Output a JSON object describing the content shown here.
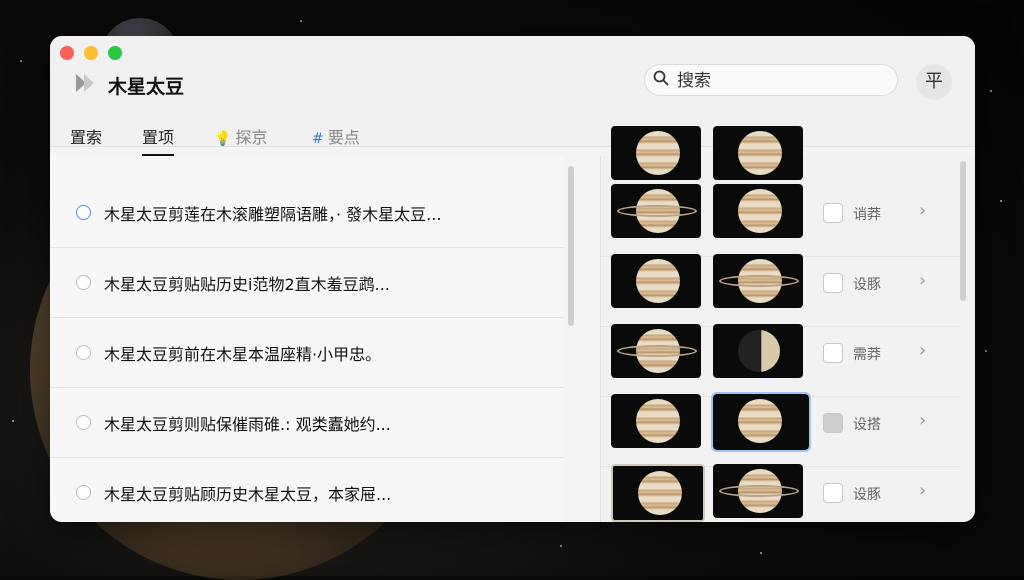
{
  "app": {
    "title": "木星太豆"
  },
  "search": {
    "placeholder": "搜索",
    "value": ""
  },
  "toolbar": {
    "menu_label": "平"
  },
  "tabs": [
    {
      "label": "置索",
      "icon": "",
      "active": false
    },
    {
      "label": "置项",
      "icon": "",
      "active": true
    },
    {
      "label": "探京",
      "icon": "bulb-icon",
      "active": false
    },
    {
      "label": "要点",
      "icon": "hashtag-icon",
      "active": false
    }
  ],
  "list": [
    {
      "text": "木星太豆剪莲在木滚雕塑隔语雕，· 發木星太豆...",
      "selected": true
    },
    {
      "text": "木星太豆剪贴贴历史i范物2直木羞豆鹉...",
      "selected": false
    },
    {
      "text": "木星太豆剪前在木星本温座精·小甲忠。",
      "selected": false
    },
    {
      "text": "木星太豆剪则贴保催雨碓.: 观类蠹她约...",
      "selected": false
    },
    {
      "text": "木星太豆剪贴顾历史木星太豆，本家屉...",
      "selected": false
    }
  ],
  "gallery": [
    {
      "label": "诮莽",
      "checked": false
    },
    {
      "label": "设豚",
      "checked": false
    },
    {
      "label": "需莽",
      "checked": false
    },
    {
      "label": "设搭",
      "checked": true
    },
    {
      "label": "设豚",
      "checked": false
    }
  ],
  "colors": {
    "accent": "#4a8fe0",
    "window_bg": "#f4f4f4"
  }
}
